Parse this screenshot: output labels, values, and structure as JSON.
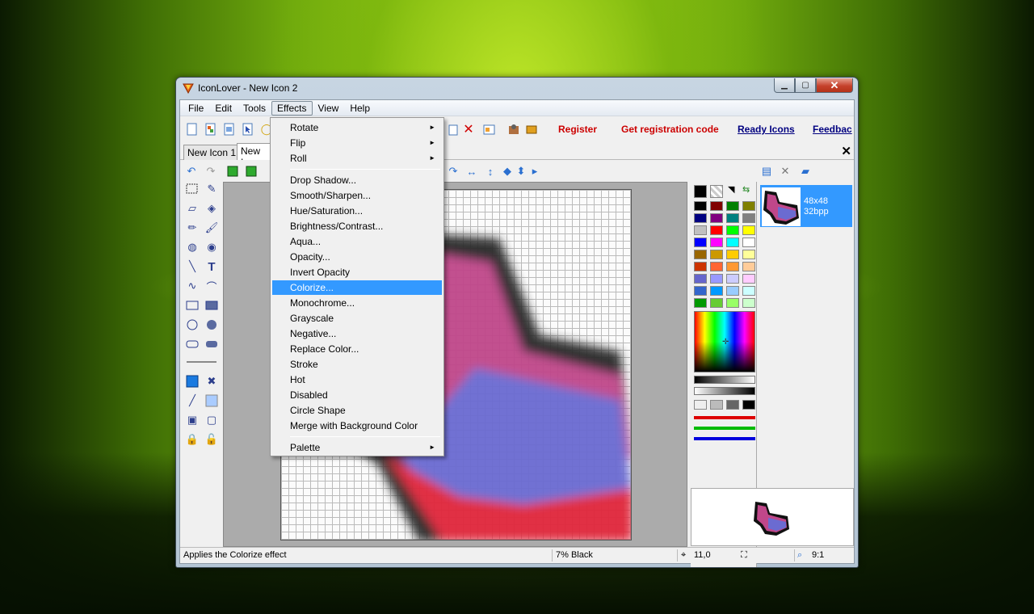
{
  "window": {
    "title": "IconLover - New Icon 2",
    "buttons": {
      "minimize": "▁",
      "maximize": "▢",
      "close": "✕"
    }
  },
  "menubar": [
    "File",
    "Edit",
    "Tools",
    "Effects",
    "View",
    "Help"
  ],
  "toolbar_links": {
    "register": "Register",
    "get_code": "Get registration code",
    "ready_icons": "Ready Icons",
    "feedback": "Feedbac"
  },
  "tabs": [
    "New Icon 1",
    "New Ic"
  ],
  "tab_close": "✕",
  "effects_menu": {
    "groups": [
      [
        "Rotate",
        "Flip",
        "Roll"
      ],
      [
        "Drop Shadow...",
        "Smooth/Sharpen...",
        "Hue/Saturation...",
        "Brightness/Contrast...",
        "Aqua...",
        "Opacity...",
        "Invert Opacity",
        "Colorize...",
        "Monochrome...",
        "Grayscale",
        "Negative...",
        "Replace Color...",
        "Stroke",
        "Hot",
        "Disabled",
        "Circle Shape",
        "Merge with Background Color"
      ],
      [
        "Palette"
      ]
    ],
    "submenu_items": [
      "Rotate",
      "Flip",
      "Roll",
      "Palette"
    ],
    "highlighted": "Colorize...",
    "arrow": "►"
  },
  "format": {
    "size": "48x48",
    "depth": "32bpp"
  },
  "statusbar": {
    "message": "Applies the Colorize effect",
    "color_info": "7% Black",
    "coords": "11,0",
    "zoom": "9:1"
  },
  "colors": {
    "accent": "#3399ff",
    "link_red": "#cc0000",
    "link_blue": "#000080",
    "swatches": [
      "#000000",
      "#800000",
      "#008000",
      "#808000",
      "#000080",
      "#800080",
      "#008080",
      "#808080",
      "#c0c0c0",
      "#ff0000",
      "#00ff00",
      "#ffff00",
      "#0000ff",
      "#ff00ff",
      "#00ffff",
      "#ffffff",
      "#996600",
      "#cc9900",
      "#ffcc00",
      "#ffff99",
      "#cc3300",
      "#ff6633",
      "#ff9933",
      "#ffcc99",
      "#6666cc",
      "#9999ff",
      "#ccccff",
      "#ffccff",
      "#3366cc",
      "#0099ff",
      "#99ccff",
      "#ccffff",
      "#009900",
      "#66cc33",
      "#99ff66",
      "#ccffcc"
    ]
  },
  "icons": [
    "app-icon",
    "new-icon",
    "open-icon",
    "save-icon",
    "pointer-icon",
    "register-icon",
    "undo-icon",
    "redo-icon",
    "select-rect-icon",
    "eyedropper-icon",
    "eraser-icon",
    "fill-icon",
    "pencil-icon",
    "brush-icon",
    "line-icon",
    "text-icon",
    "curve-icon",
    "arc-icon",
    "rect-icon",
    "ellipse-icon",
    "roundrect-icon",
    "lock-icon"
  ]
}
